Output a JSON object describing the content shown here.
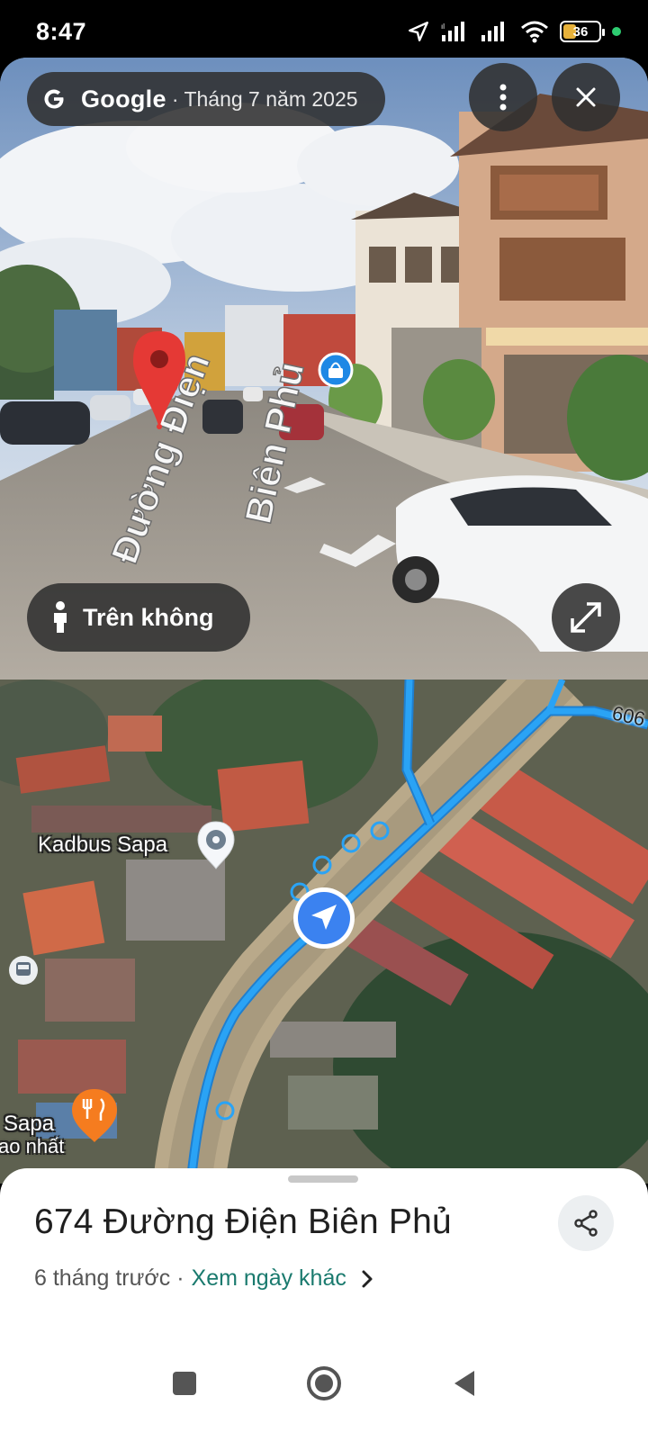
{
  "status_bar": {
    "time": "8:47",
    "battery_level": "36",
    "icons": [
      "location-arrow-icon",
      "signal-icon",
      "signal-icon",
      "wifi-icon",
      "battery-icon"
    ]
  },
  "street_view": {
    "brand": "Google",
    "date": "· Tháng 7 năm 2025",
    "aerial_label": "Trên không",
    "road_text_1": "Đường Điện",
    "road_text_2": "Biên Phủ"
  },
  "map": {
    "poi_kadbus": "Kadbus Sapa",
    "poi_sapa": "Sapa",
    "poi_sapa_sub": "ao nhất",
    "road_number": "606"
  },
  "sheet": {
    "title": "674 Đường Điện Biên Phủ",
    "time_ago": "6 tháng trước ·",
    "other_dates_link": "Xem ngày khác"
  },
  "colors": {
    "route_blue": "#2aa3f5",
    "pin_red": "#e53935",
    "link_teal": "#1a7a6e",
    "restaurant_orange": "#f57c1f",
    "battery_yellow": "#e8b23a"
  }
}
